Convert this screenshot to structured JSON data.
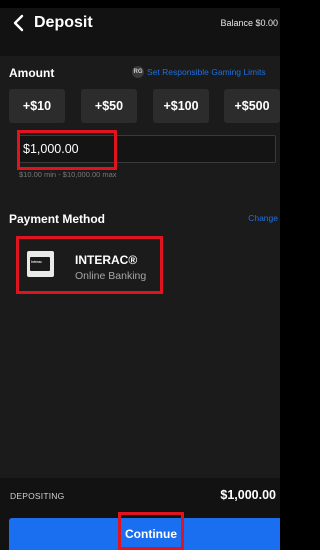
{
  "header": {
    "title": "Deposit",
    "balance": "Balance $0.00",
    "back_icon": "chevron-left-icon"
  },
  "amount": {
    "label": "Amount",
    "responsible_gaming_icon_text": "RG",
    "responsible_gaming_link": "Set Responsible Gaming Limits",
    "quick_amounts": [
      "+$10",
      "+$50",
      "+$100",
      "+$500"
    ],
    "input_value": "$1,000.00",
    "limits_text": "$10.00 min - $10,000.00 max"
  },
  "payment": {
    "label": "Payment Method",
    "change_link": "Change",
    "logo_text": "Interac",
    "method_name": "INTERAC®",
    "method_sub": "Online Banking"
  },
  "footer": {
    "depositing_label": "DEPOSITING",
    "depositing_value": "$1,000.00",
    "continue_label": "Continue"
  },
  "colors": {
    "accent": "#1a6ff0",
    "link": "#1e6fe0",
    "highlight": "#e0141e",
    "background": "#1b1b1b"
  }
}
